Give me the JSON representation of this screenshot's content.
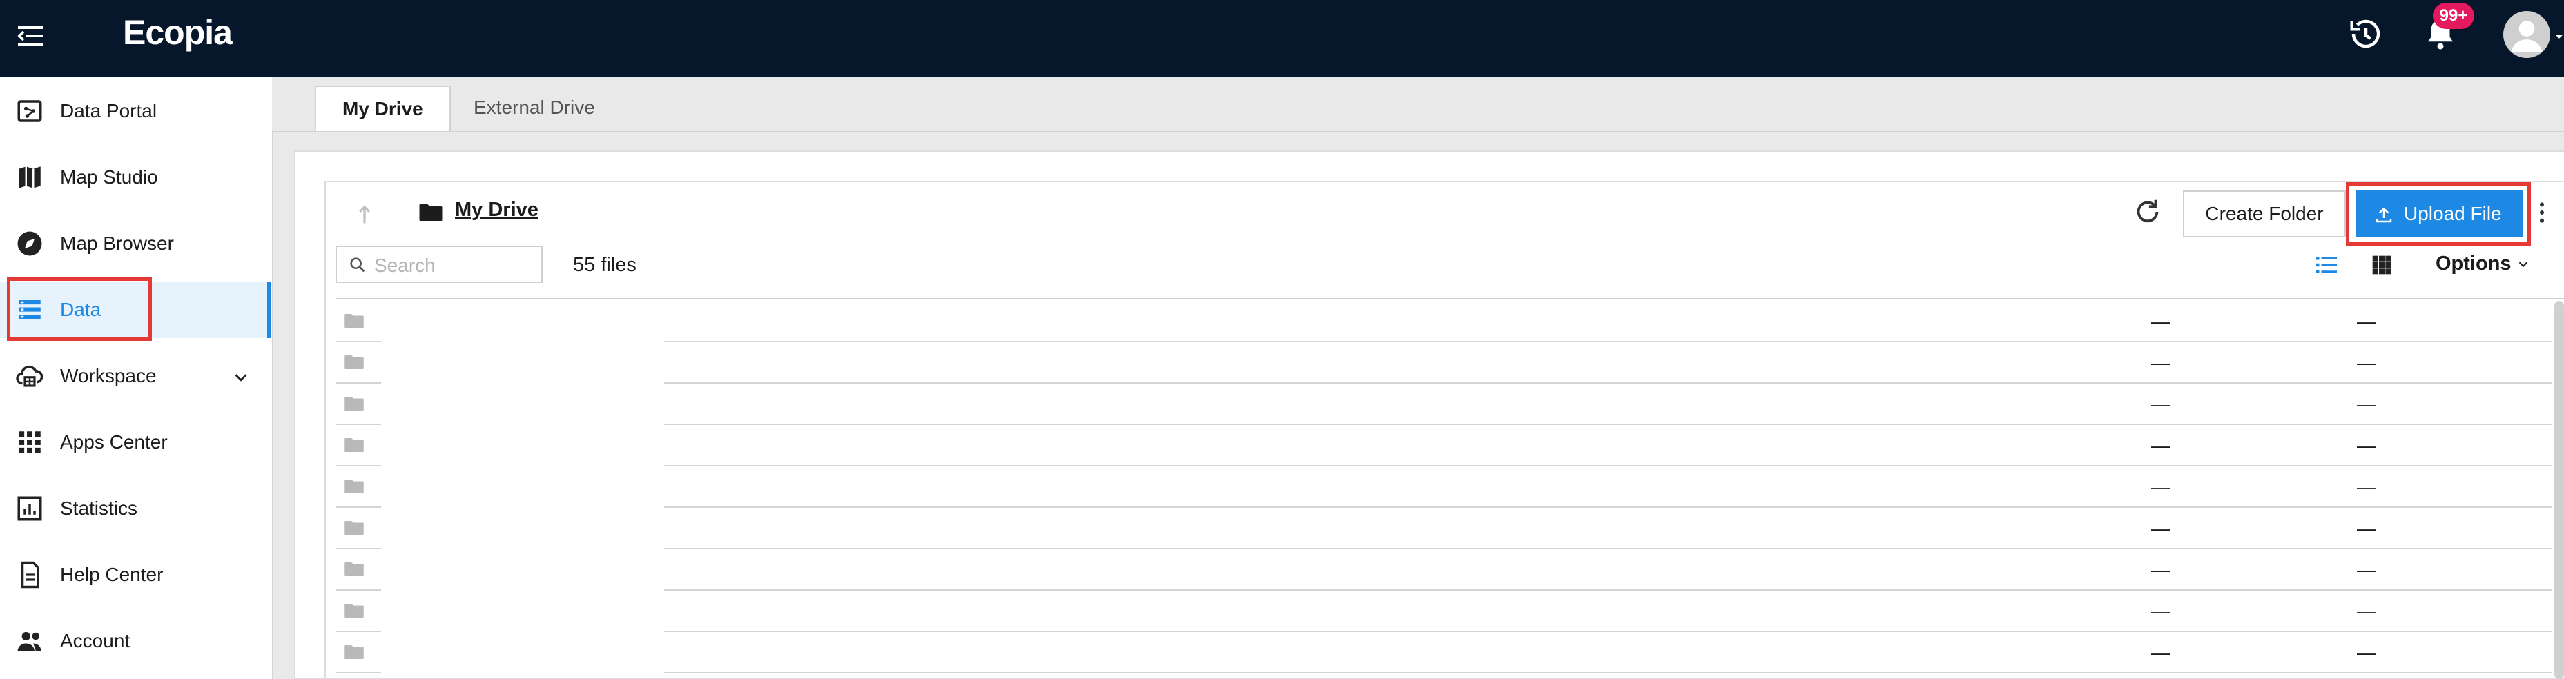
{
  "app": {
    "logo_text": "Ecopia",
    "notification_count": "99+"
  },
  "colors": {
    "topbar": "#06172b",
    "accent": "#1e88e5",
    "highlight": "#e53935",
    "badge": "#e5195e"
  },
  "sidebar": {
    "items": [
      {
        "label": "Data Portal",
        "icon": "data-portal-icon"
      },
      {
        "label": "Map Studio",
        "icon": "map-icon"
      },
      {
        "label": "Map Browser",
        "icon": "compass-icon"
      },
      {
        "label": "Data",
        "icon": "list-icon",
        "active": true
      },
      {
        "label": "Workspace",
        "icon": "cloud-icon",
        "expandable": true
      },
      {
        "label": "Apps Center",
        "icon": "apps-grid-icon"
      },
      {
        "label": "Statistics",
        "icon": "bar-chart-icon"
      },
      {
        "label": "Help Center",
        "icon": "document-icon"
      },
      {
        "label": "Account",
        "icon": "people-icon"
      }
    ]
  },
  "tabs": [
    {
      "label": "My Drive",
      "active": true
    },
    {
      "label": "External Drive",
      "active": false
    }
  ],
  "toolbar": {
    "breadcrumb": "My Drive",
    "create_folder": "Create Folder",
    "upload_file": "Upload File",
    "search_placeholder": "Search",
    "file_count": "55 files",
    "options": "Options"
  },
  "rows": [
    {
      "col1": "—",
      "col2": "—"
    },
    {
      "col1": "—",
      "col2": "—"
    },
    {
      "col1": "—",
      "col2": "—"
    },
    {
      "col1": "—",
      "col2": "—"
    },
    {
      "col1": "—",
      "col2": "—"
    },
    {
      "col1": "—",
      "col2": "—"
    },
    {
      "col1": "—",
      "col2": "—"
    },
    {
      "col1": "—",
      "col2": "—"
    },
    {
      "col1": "—",
      "col2": "—"
    }
  ]
}
